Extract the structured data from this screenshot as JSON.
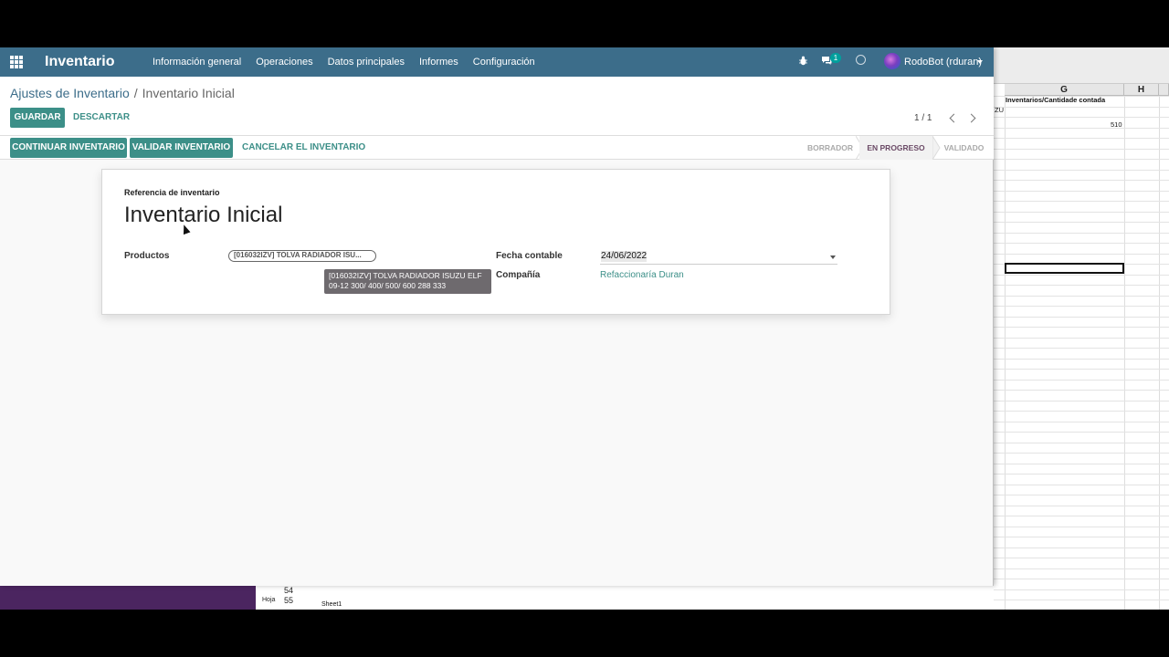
{
  "app": {
    "name": "Inventario",
    "menu": [
      "Información general",
      "Operaciones",
      "Datos principales",
      "Informes",
      "Configuración"
    ],
    "chat_badge": "1",
    "user": "RodoBot (rduran)"
  },
  "breadcrumb": {
    "parent": "Ajustes de Inventario",
    "separator": "/",
    "current": "Inventario Inicial"
  },
  "actions": {
    "save": "GUARDAR",
    "discard": "DESCARTAR",
    "continue": "CONTINUAR INVENTARIO",
    "validate": "VALIDAR INVENTARIO",
    "cancel": "CANCELAR EL INVENTARIO"
  },
  "pager": "1 / 1",
  "stages": [
    "BORRADOR",
    "EN PROGRESO",
    "VALIDADO"
  ],
  "form": {
    "ref_label": "Referencia de inventario",
    "ref_value": "Inventario Inicial",
    "products_label": "Productos",
    "product_tag": "[016032IZV] TOLVA RADIADOR ISU...",
    "tooltip_line1": "[016032IZV] TOLVA RADIADOR ISUZU ELF",
    "tooltip_line2": "09-12 300/ 400/ 500/ 600 288 333",
    "date_label": "Fecha contable",
    "date_value": "24/06/2022",
    "company_label": "Compañía",
    "company_value": "Refaccionaría Duran"
  },
  "spreadsheet": {
    "col_g": "G",
    "col_h": "H",
    "header_text": "Inventarios/Cantidade contada",
    "cell_partial": "ZU",
    "cell_value": "510",
    "row_54": "54",
    "row_55": "55",
    "sheet_label": "Hoja",
    "sheet_tab": "Sheet1"
  },
  "colors": {
    "navbar": "#3c6d8a",
    "primary": "#3c8f88",
    "active_stage": "#6b4a66"
  }
}
